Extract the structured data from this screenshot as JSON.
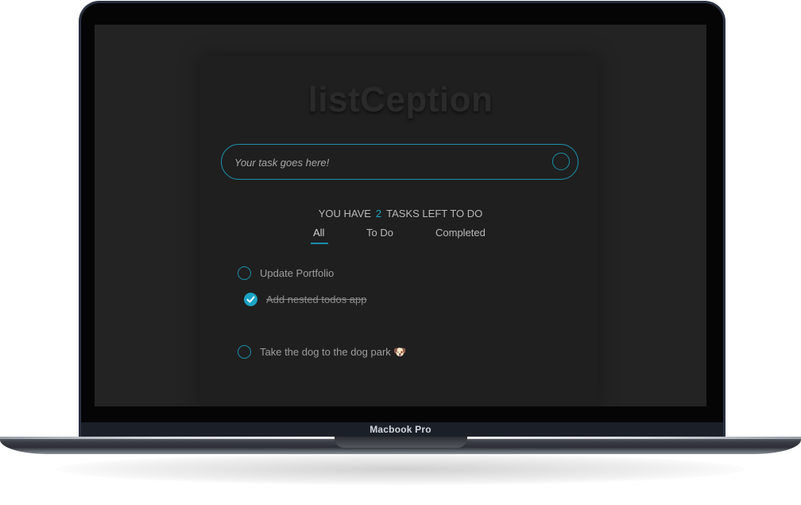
{
  "device": {
    "model_label": "Macbook Pro"
  },
  "app": {
    "title": "listCeption",
    "input": {
      "placeholder": "Your task goes here!",
      "value": ""
    },
    "counter": {
      "prefix": "YOU HAVE",
      "count": "2",
      "suffix": "TASKS LEFT TO DO"
    },
    "tabs": [
      {
        "label": "All",
        "active": true
      },
      {
        "label": "To Do",
        "active": false
      },
      {
        "label": "Completed",
        "active": false
      }
    ],
    "todos": [
      {
        "label": "Update Portfolio",
        "completed": false,
        "nested": false
      },
      {
        "label": "Add nested todos app",
        "completed": true,
        "nested": true
      },
      {
        "label": "Take the dog to the dog park 🐶",
        "completed": false,
        "nested": false
      }
    ],
    "accent_color": "#1aa3c4"
  }
}
